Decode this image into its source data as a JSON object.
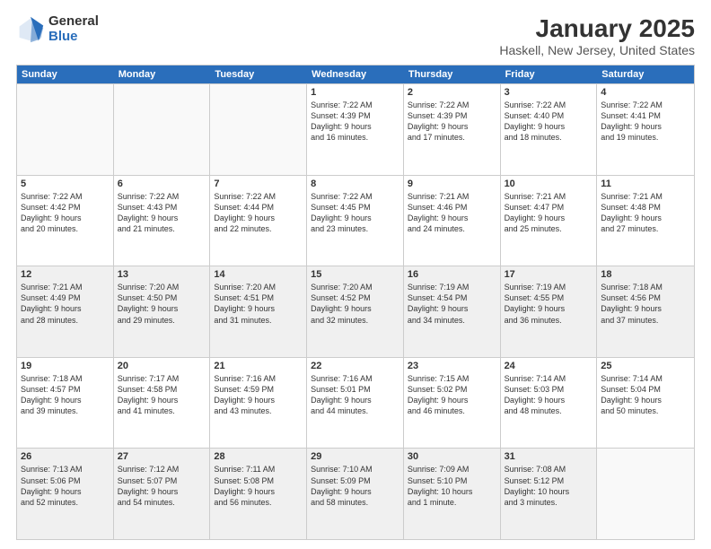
{
  "logo": {
    "general": "General",
    "blue": "Blue"
  },
  "header": {
    "month": "January 2025",
    "location": "Haskell, New Jersey, United States"
  },
  "weekdays": [
    "Sunday",
    "Monday",
    "Tuesday",
    "Wednesday",
    "Thursday",
    "Friday",
    "Saturday"
  ],
  "rows": [
    [
      {
        "day": "",
        "info": "",
        "empty": true
      },
      {
        "day": "",
        "info": "",
        "empty": true
      },
      {
        "day": "",
        "info": "",
        "empty": true
      },
      {
        "day": "1",
        "info": "Sunrise: 7:22 AM\nSunset: 4:39 PM\nDaylight: 9 hours\nand 16 minutes."
      },
      {
        "day": "2",
        "info": "Sunrise: 7:22 AM\nSunset: 4:39 PM\nDaylight: 9 hours\nand 17 minutes."
      },
      {
        "day": "3",
        "info": "Sunrise: 7:22 AM\nSunset: 4:40 PM\nDaylight: 9 hours\nand 18 minutes."
      },
      {
        "day": "4",
        "info": "Sunrise: 7:22 AM\nSunset: 4:41 PM\nDaylight: 9 hours\nand 19 minutes."
      }
    ],
    [
      {
        "day": "5",
        "info": "Sunrise: 7:22 AM\nSunset: 4:42 PM\nDaylight: 9 hours\nand 20 minutes."
      },
      {
        "day": "6",
        "info": "Sunrise: 7:22 AM\nSunset: 4:43 PM\nDaylight: 9 hours\nand 21 minutes."
      },
      {
        "day": "7",
        "info": "Sunrise: 7:22 AM\nSunset: 4:44 PM\nDaylight: 9 hours\nand 22 minutes."
      },
      {
        "day": "8",
        "info": "Sunrise: 7:22 AM\nSunset: 4:45 PM\nDaylight: 9 hours\nand 23 minutes."
      },
      {
        "day": "9",
        "info": "Sunrise: 7:21 AM\nSunset: 4:46 PM\nDaylight: 9 hours\nand 24 minutes."
      },
      {
        "day": "10",
        "info": "Sunrise: 7:21 AM\nSunset: 4:47 PM\nDaylight: 9 hours\nand 25 minutes."
      },
      {
        "day": "11",
        "info": "Sunrise: 7:21 AM\nSunset: 4:48 PM\nDaylight: 9 hours\nand 27 minutes."
      }
    ],
    [
      {
        "day": "12",
        "info": "Sunrise: 7:21 AM\nSunset: 4:49 PM\nDaylight: 9 hours\nand 28 minutes.",
        "shaded": true
      },
      {
        "day": "13",
        "info": "Sunrise: 7:20 AM\nSunset: 4:50 PM\nDaylight: 9 hours\nand 29 minutes.",
        "shaded": true
      },
      {
        "day": "14",
        "info": "Sunrise: 7:20 AM\nSunset: 4:51 PM\nDaylight: 9 hours\nand 31 minutes.",
        "shaded": true
      },
      {
        "day": "15",
        "info": "Sunrise: 7:20 AM\nSunset: 4:52 PM\nDaylight: 9 hours\nand 32 minutes.",
        "shaded": true
      },
      {
        "day": "16",
        "info": "Sunrise: 7:19 AM\nSunset: 4:54 PM\nDaylight: 9 hours\nand 34 minutes.",
        "shaded": true
      },
      {
        "day": "17",
        "info": "Sunrise: 7:19 AM\nSunset: 4:55 PM\nDaylight: 9 hours\nand 36 minutes.",
        "shaded": true
      },
      {
        "day": "18",
        "info": "Sunrise: 7:18 AM\nSunset: 4:56 PM\nDaylight: 9 hours\nand 37 minutes.",
        "shaded": true
      }
    ],
    [
      {
        "day": "19",
        "info": "Sunrise: 7:18 AM\nSunset: 4:57 PM\nDaylight: 9 hours\nand 39 minutes."
      },
      {
        "day": "20",
        "info": "Sunrise: 7:17 AM\nSunset: 4:58 PM\nDaylight: 9 hours\nand 41 minutes."
      },
      {
        "day": "21",
        "info": "Sunrise: 7:16 AM\nSunset: 4:59 PM\nDaylight: 9 hours\nand 43 minutes."
      },
      {
        "day": "22",
        "info": "Sunrise: 7:16 AM\nSunset: 5:01 PM\nDaylight: 9 hours\nand 44 minutes."
      },
      {
        "day": "23",
        "info": "Sunrise: 7:15 AM\nSunset: 5:02 PM\nDaylight: 9 hours\nand 46 minutes."
      },
      {
        "day": "24",
        "info": "Sunrise: 7:14 AM\nSunset: 5:03 PM\nDaylight: 9 hours\nand 48 minutes."
      },
      {
        "day": "25",
        "info": "Sunrise: 7:14 AM\nSunset: 5:04 PM\nDaylight: 9 hours\nand 50 minutes."
      }
    ],
    [
      {
        "day": "26",
        "info": "Sunrise: 7:13 AM\nSunset: 5:06 PM\nDaylight: 9 hours\nand 52 minutes.",
        "shaded": true
      },
      {
        "day": "27",
        "info": "Sunrise: 7:12 AM\nSunset: 5:07 PM\nDaylight: 9 hours\nand 54 minutes.",
        "shaded": true
      },
      {
        "day": "28",
        "info": "Sunrise: 7:11 AM\nSunset: 5:08 PM\nDaylight: 9 hours\nand 56 minutes.",
        "shaded": true
      },
      {
        "day": "29",
        "info": "Sunrise: 7:10 AM\nSunset: 5:09 PM\nDaylight: 9 hours\nand 58 minutes.",
        "shaded": true
      },
      {
        "day": "30",
        "info": "Sunrise: 7:09 AM\nSunset: 5:10 PM\nDaylight: 10 hours\nand 1 minute.",
        "shaded": true
      },
      {
        "day": "31",
        "info": "Sunrise: 7:08 AM\nSunset: 5:12 PM\nDaylight: 10 hours\nand 3 minutes.",
        "shaded": true
      },
      {
        "day": "",
        "info": "",
        "empty": true,
        "shaded": false
      }
    ]
  ]
}
